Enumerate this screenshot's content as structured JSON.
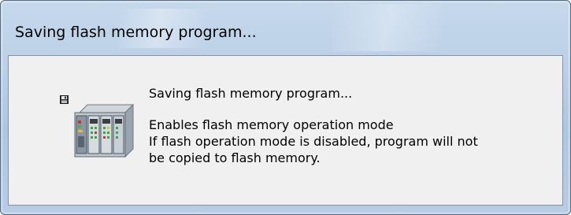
{
  "window": {
    "title": "Saving flash memory program..."
  },
  "dialog": {
    "heading": "Saving flash memory program...",
    "lines": [
      "Enables flash memory operation mode",
      "If flash operation mode is disabled, program will not",
      "be copied to flash memory."
    ]
  },
  "icons": {
    "status": "floppy-save-icon",
    "device": "plc-rack-icon"
  },
  "colors": {
    "titlebar": "#b9cfe5",
    "client_bg": "#f0f0f0",
    "frame_border": "#5b6e83"
  }
}
